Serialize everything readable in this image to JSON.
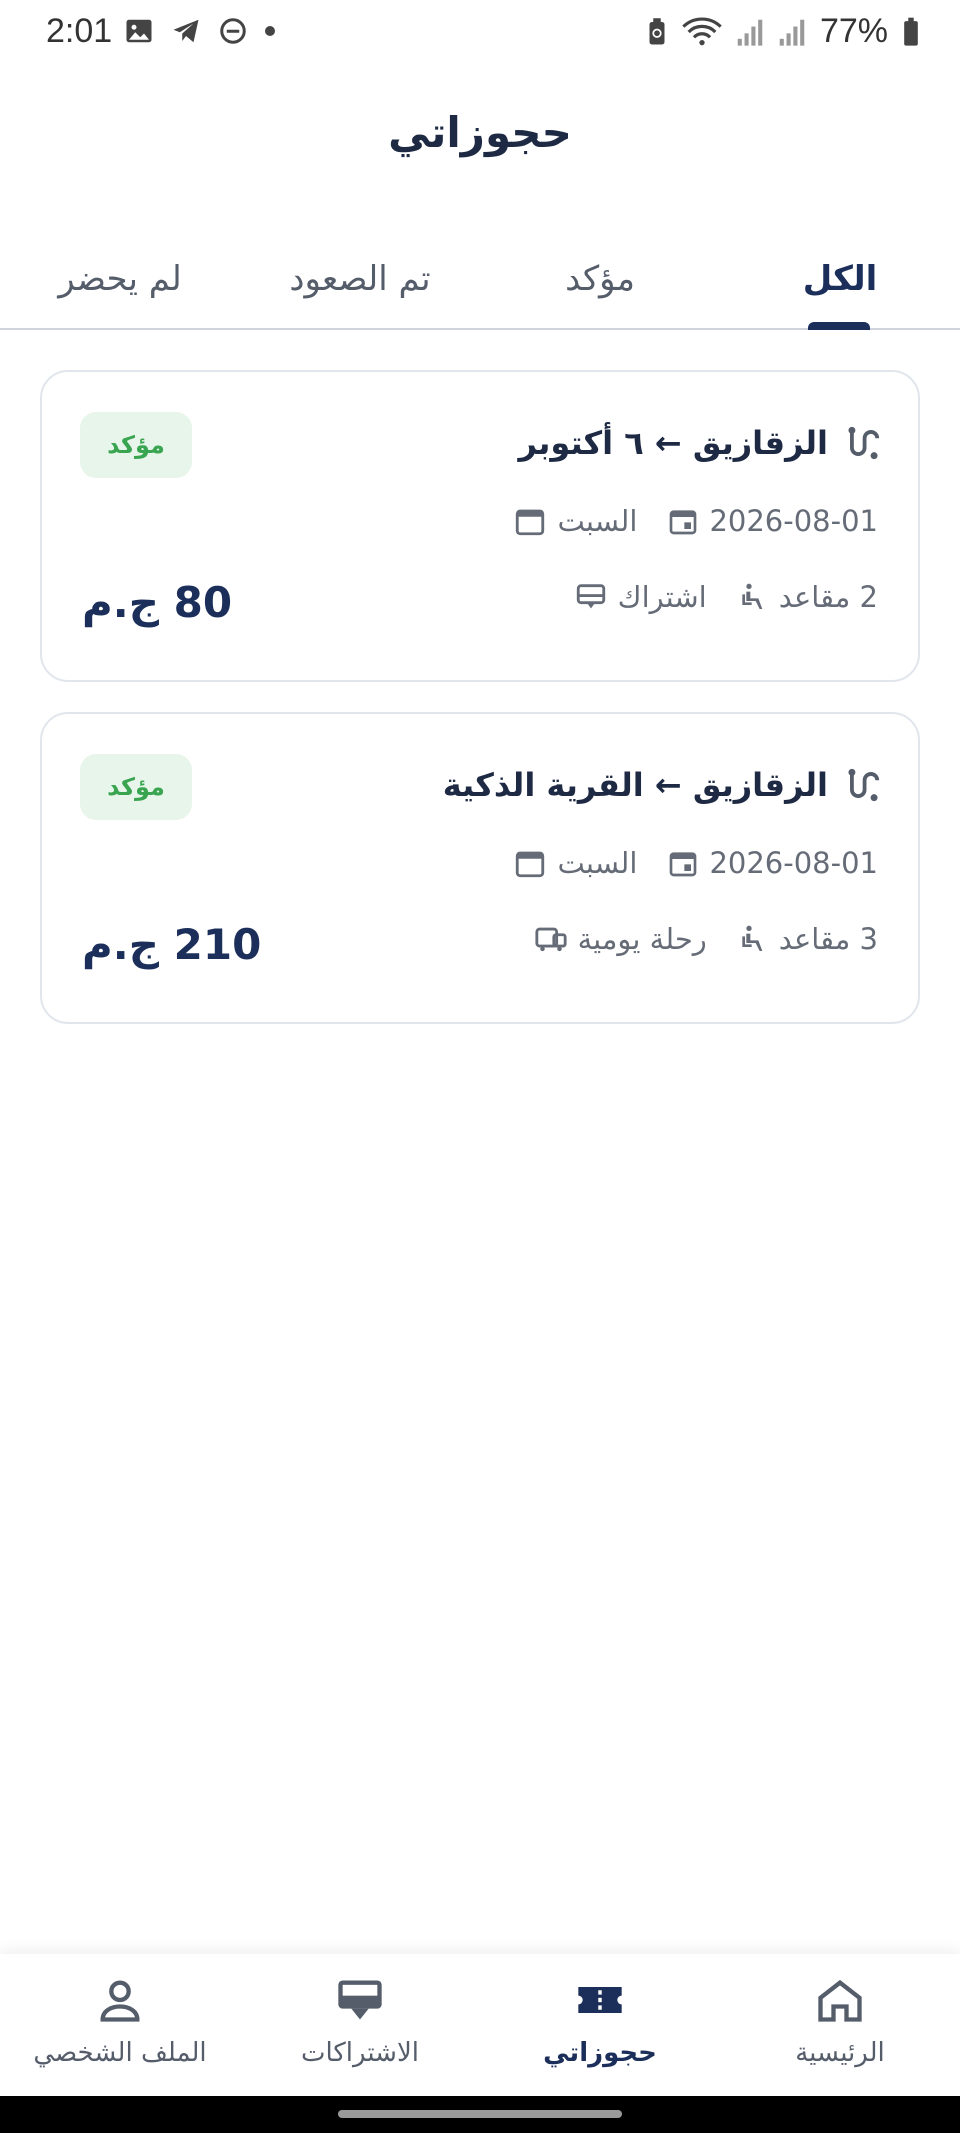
{
  "status_bar": {
    "time": "2:01",
    "battery": "77%"
  },
  "header": {
    "title": "حجوزاتي"
  },
  "tabs": [
    {
      "label": "الكل",
      "active": true
    },
    {
      "label": "مؤكد",
      "active": false
    },
    {
      "label": "تم الصعود",
      "active": false
    },
    {
      "label": "لم يحضر",
      "active": false
    }
  ],
  "bookings": [
    {
      "route": "الزقازيق ← ٦ أكتوبر",
      "status": "مؤكد",
      "day": "السبت",
      "date": "2026-08-01",
      "type": "اشتراك",
      "seats": "2 مقاعد",
      "price": "80 ج.م"
    },
    {
      "route": "الزقازيق ← القرية الذكية",
      "status": "مؤكد",
      "day": "السبت",
      "date": "2026-08-01",
      "type": "رحلة يومية",
      "seats": "3 مقاعد",
      "price": "210 ج.م"
    }
  ],
  "bottom_nav": [
    {
      "label": "الرئيسية",
      "icon": "home-icon",
      "active": false
    },
    {
      "label": "حجوزاتي",
      "icon": "ticket-icon",
      "active": true
    },
    {
      "label": "الاشتراكات",
      "icon": "bus-card-icon",
      "active": false
    },
    {
      "label": "الملف الشخصي",
      "icon": "person-icon",
      "active": false
    }
  ],
  "colors": {
    "primary": "#1b2f5a",
    "success": "#3aa551",
    "success_bg": "#e8f5ea"
  }
}
